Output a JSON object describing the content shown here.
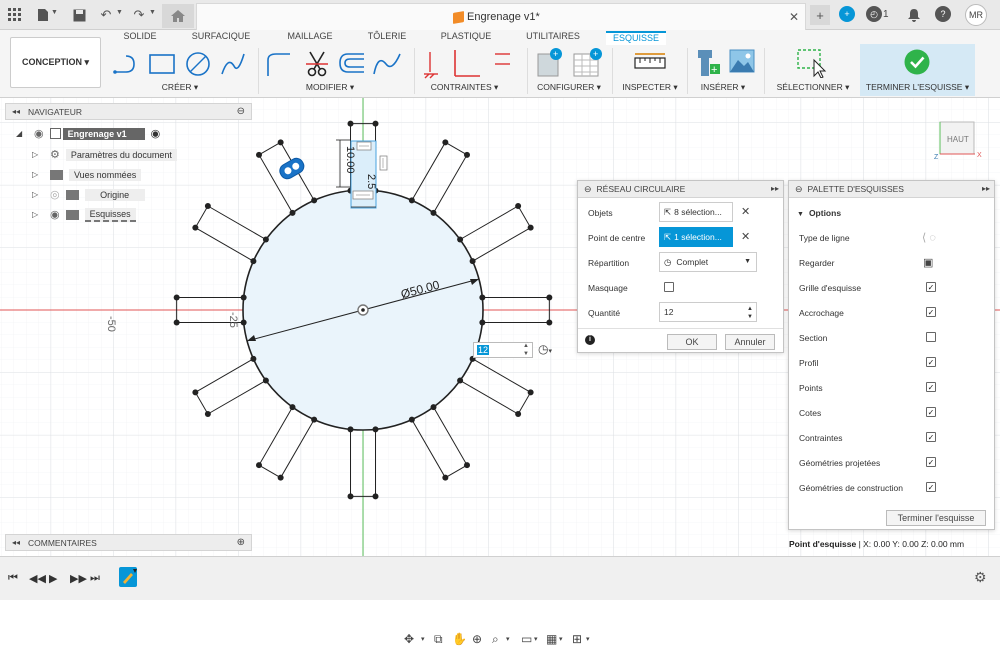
{
  "titlebar": {
    "document_title": "Engrenage v1*",
    "user_initials": "MR",
    "jobs_count": "1"
  },
  "ribbon": {
    "workspace": "CONCEPTION ▾",
    "tabs": [
      "SOLIDE",
      "SURFACIQUE",
      "MAILLAGE",
      "TÔLERIE",
      "PLASTIQUE",
      "UTILITAIRES",
      "ESQUISSE"
    ],
    "active_tab": "ESQUISSE",
    "groups": [
      "CRÉER ▾",
      "MODIFIER ▾",
      "CONTRAINTES ▾",
      "CONFIGURER ▾",
      "INSPECTER ▾",
      "INSÉRER ▾",
      "SÉLECTIONNER ▾",
      "TERMINER L'ESQUISSE ▾"
    ]
  },
  "navigator": {
    "title": "NAVIGATEUR",
    "root": "Engrenage v1",
    "items": [
      "Paramètres du document",
      "Vues nommées",
      "Origine",
      "Esquisses"
    ]
  },
  "comments": {
    "title": "COMMENTAIRES"
  },
  "sketch": {
    "diameter_label": "Ø50.00",
    "dim_height": "10.00",
    "dim_width": "2.5",
    "axis_label_left": "-50",
    "axis_label_near": "-25",
    "quantity_inline": "12",
    "view_cube_label": "HAUT"
  },
  "pattern_dialog": {
    "title": "RÉSEAU CIRCULAIRE",
    "objects_label": "Objets",
    "objects_value": "8 sélection...",
    "center_label": "Point de centre",
    "center_value": "1 sélection...",
    "distribution_label": "Répartition",
    "distribution_value": "Complet",
    "suppression_label": "Masquage",
    "quantity_label": "Quantité",
    "quantity_value": "12",
    "ok_label": "OK",
    "cancel_label": "Annuler"
  },
  "palette": {
    "title": "PALETTE D'ESQUISSES",
    "section": "Options",
    "rows": [
      {
        "label": "Type de ligne",
        "kind": "icons"
      },
      {
        "label": "Regarder",
        "kind": "icon"
      },
      {
        "label": "Grille d'esquisse",
        "kind": "check",
        "checked": true
      },
      {
        "label": "Accrochage",
        "kind": "check",
        "checked": true
      },
      {
        "label": "Section",
        "kind": "check",
        "checked": false
      },
      {
        "label": "Profil",
        "kind": "check",
        "checked": true
      },
      {
        "label": "Points",
        "kind": "check",
        "checked": true
      },
      {
        "label": "Cotes",
        "kind": "check",
        "checked": true
      },
      {
        "label": "Contraintes",
        "kind": "check",
        "checked": true
      },
      {
        "label": "Géométries projetées",
        "kind": "check",
        "checked": true
      },
      {
        "label": "Géométries de construction",
        "kind": "check",
        "checked": true
      }
    ],
    "finish_button": "Terminer l'esquisse"
  },
  "status": {
    "label": "Point d'esquisse",
    "coords": " | X: 0.00 Y: 0.00 Z: 0.00 mm"
  },
  "colors": {
    "accent": "#0696d7",
    "finish_green": "#2fb34a",
    "sketch_fill": "#eaf4fb",
    "axis_red": "#e05555",
    "axis_green": "#5bbf5b"
  }
}
